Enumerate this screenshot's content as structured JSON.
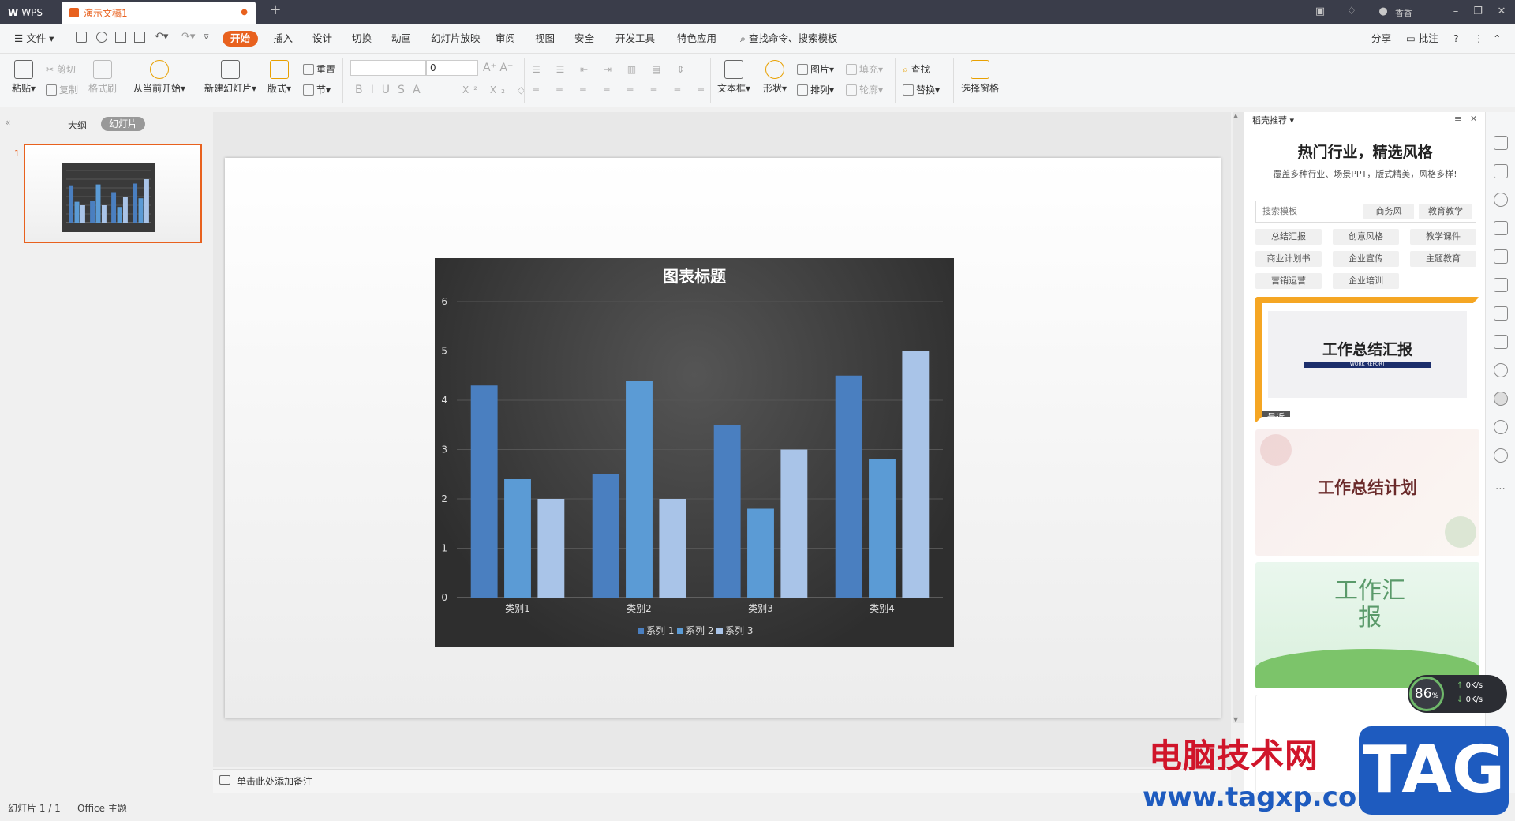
{
  "titlebar": {
    "app_tab": "WPS",
    "doc_tab": "演示文稿1",
    "user": "香香"
  },
  "menubar": {
    "file": "文件",
    "items": [
      "开始",
      "插入",
      "设计",
      "切换",
      "动画",
      "幻灯片放映",
      "审阅",
      "视图",
      "安全",
      "开发工具",
      "特色应用"
    ],
    "search": "查找命令、搜索模板",
    "share": "分享",
    "comment": "批注"
  },
  "ribbon": {
    "paste": "粘贴",
    "cut": "剪切",
    "copy": "复制",
    "format_painter": "格式刷",
    "from_current": "从当前开始",
    "new_slide": "新建幻灯片",
    "layout": "版式",
    "reset": "重置",
    "section": "节",
    "font_size": "0",
    "textbox": "文本框",
    "shape": "形状",
    "picture": "图片",
    "fill": "填充",
    "arrange": "排列",
    "outline": "轮廓",
    "find": "查找",
    "replace": "替换",
    "select_pane": "选择窗格"
  },
  "leftpanel": {
    "tab_outline": "大纲",
    "tab_slides": "幻灯片",
    "slide_number": "1"
  },
  "chart_data": {
    "type": "bar",
    "title": "图表标题",
    "categories": [
      "类别1",
      "类别2",
      "类别3",
      "类别4"
    ],
    "series": [
      {
        "name": "系列 1",
        "values": [
          4.3,
          2.5,
          3.5,
          4.5
        ],
        "color": "#4a7fc0"
      },
      {
        "name": "系列 2",
        "values": [
          2.4,
          4.4,
          1.8,
          2.8
        ],
        "color": "#5b9bd5"
      },
      {
        "name": "系列 3",
        "values": [
          2.0,
          2.0,
          3.0,
          5.0
        ],
        "color": "#a9c4e8"
      }
    ],
    "ylim": [
      0,
      6
    ],
    "yticks": [
      "0",
      "1",
      "2",
      "3",
      "4",
      "5",
      "6"
    ],
    "grid": true,
    "legend": "bottom"
  },
  "notes": {
    "placeholder": "单击此处添加备注"
  },
  "rightpanel": {
    "header": "稻壳推荐",
    "headline": "热门行业，精选风格",
    "subline": "覆盖多种行业、场景PPT，版式精美，风格多样!",
    "search_placeholder": "搜索模板",
    "quick_tags": [
      "商务风",
      "教育教学"
    ],
    "tags": [
      "总结汇报",
      "创意风格",
      "教学课件",
      "商业计划书",
      "企业宣传",
      "主题教育",
      "营销运营",
      "企业培训"
    ],
    "templates": [
      {
        "title": "工作总结汇报",
        "sub": "WORK REPORT",
        "badge": "最近"
      },
      {
        "title": "工作总结计划"
      },
      {
        "title": "工作汇报"
      }
    ]
  },
  "status": {
    "slide_info": "幻灯片 1 / 1",
    "theme": "Office 主题"
  },
  "widget": {
    "percent": "86",
    "up": "0K/s",
    "down": "0K/s"
  },
  "watermark": {
    "site": "电脑技术网",
    "url": "www.tagxp.com",
    "tag": "TAG"
  }
}
